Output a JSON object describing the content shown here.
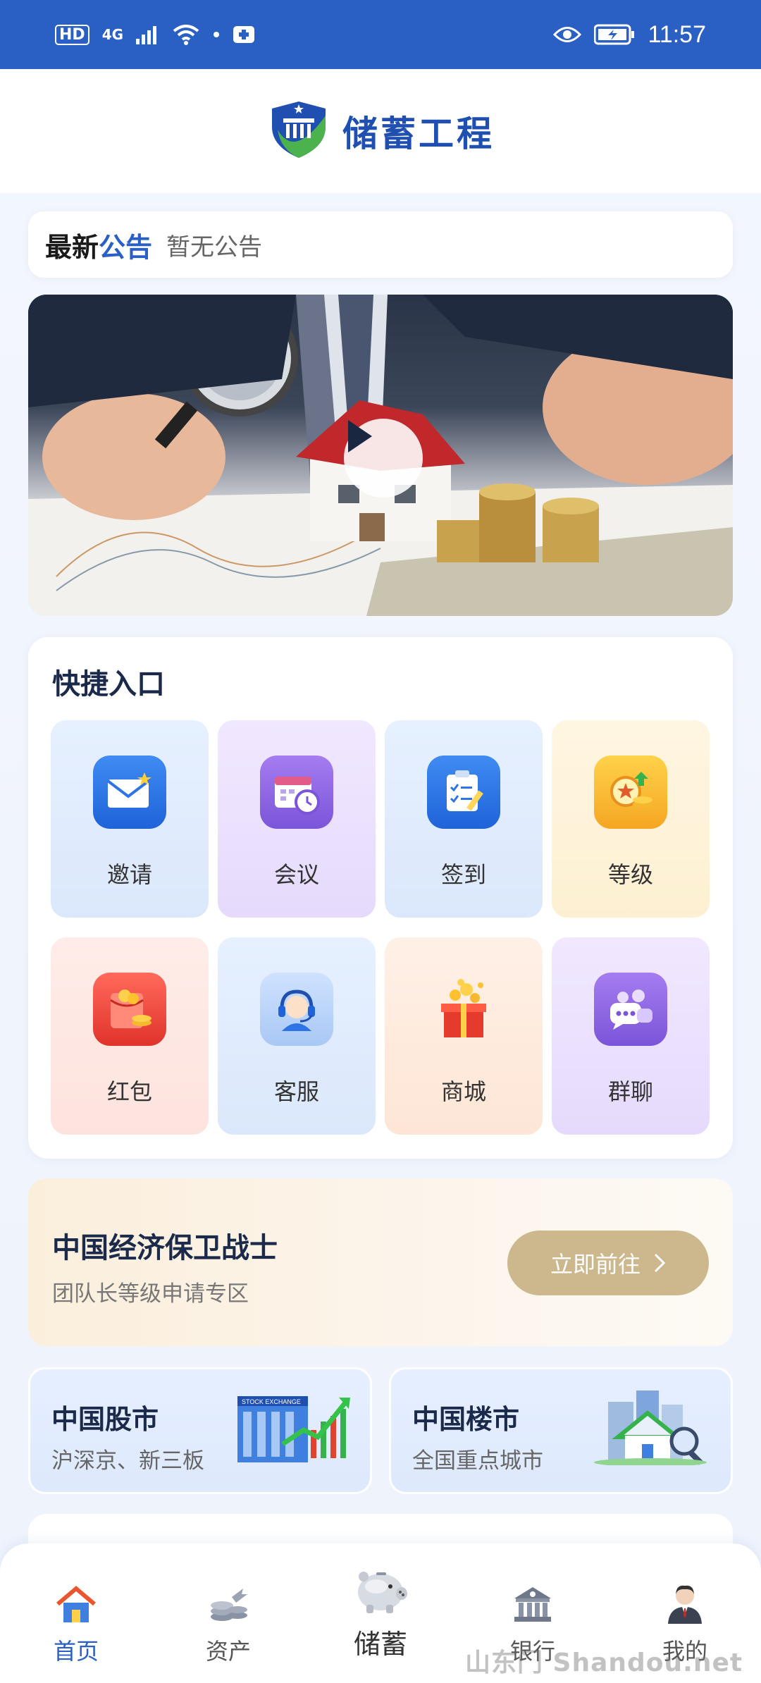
{
  "status_bar": {
    "hd": "HD",
    "network": "4G",
    "time": "11:57"
  },
  "header": {
    "title": "储蓄工程"
  },
  "notice": {
    "title_a": "最新",
    "title_b": "公告",
    "text": "暂无公告"
  },
  "quick": {
    "title": "快捷入口",
    "items": [
      {
        "label": "邀请",
        "icon": "envelope-star-icon"
      },
      {
        "label": "会议",
        "icon": "calendar-clock-icon"
      },
      {
        "label": "签到",
        "icon": "clipboard-check-icon"
      },
      {
        "label": "等级",
        "icon": "medal-coins-icon"
      },
      {
        "label": "红包",
        "icon": "red-envelope-icon"
      },
      {
        "label": "客服",
        "icon": "headset-icon"
      },
      {
        "label": "商城",
        "icon": "gift-box-icon"
      },
      {
        "label": "群聊",
        "icon": "chat-bubbles-icon"
      }
    ]
  },
  "promo": {
    "title": "中国经济保卫战士",
    "subtitle": "团队长等级申请专区",
    "button": "立即前往"
  },
  "markets": [
    {
      "title": "中国股市",
      "subtitle": "沪深京、新三板",
      "art_text": "STOCK EXCHANGE"
    },
    {
      "title": "中国楼市",
      "subtitle": "全国重点城市"
    }
  ],
  "tabs": [
    {
      "label": "首页"
    },
    {
      "label": "资产"
    },
    {
      "label": "储蓄"
    },
    {
      "label": "银行"
    },
    {
      "label": "我的"
    }
  ],
  "watermark": "山东门 Shandou.net",
  "colors": {
    "primary": "#2a5fc4",
    "gold": "#cdb78d"
  }
}
